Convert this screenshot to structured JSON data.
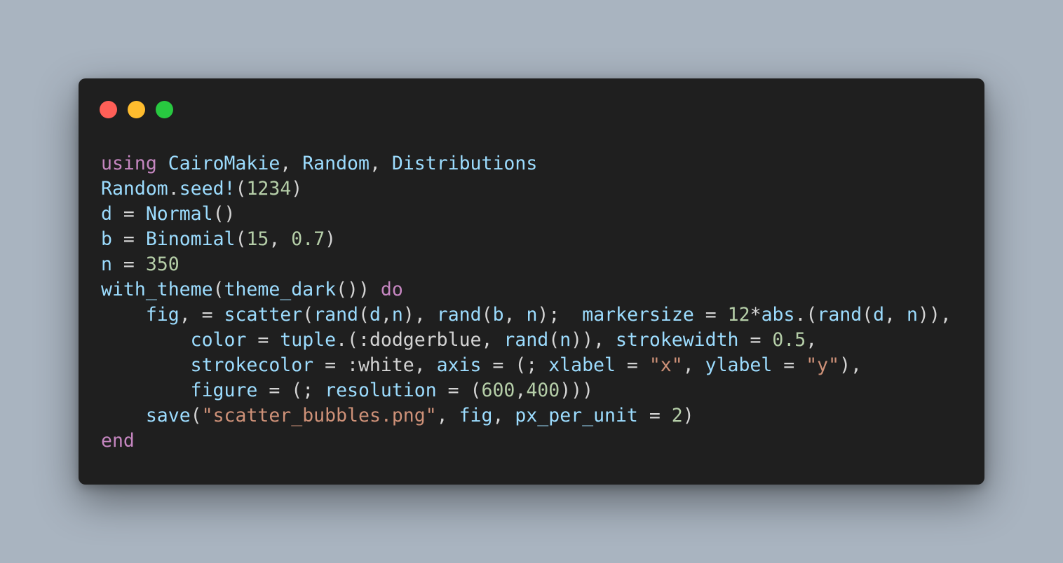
{
  "window": {
    "controls": [
      {
        "name": "close",
        "color": "#ff5f57"
      },
      {
        "name": "minimize",
        "color": "#febc2e"
      },
      {
        "name": "maximize",
        "color": "#28c840"
      }
    ]
  },
  "colors": {
    "keyword": "#c586c0",
    "identifier": "#9cdcfe",
    "number": "#b5cea8",
    "string": "#ce9178",
    "plain": "#d4d4d4"
  },
  "code_lines": [
    [
      [
        "keyword",
        "using"
      ],
      [
        "plain",
        " "
      ],
      [
        "identifier",
        "CairoMakie"
      ],
      [
        "plain",
        ", "
      ],
      [
        "identifier",
        "Random"
      ],
      [
        "plain",
        ", "
      ],
      [
        "identifier",
        "Distributions"
      ]
    ],
    [
      [
        "identifier",
        "Random"
      ],
      [
        "plain",
        "."
      ],
      [
        "identifier",
        "seed!"
      ],
      [
        "plain",
        "("
      ],
      [
        "number",
        "1234"
      ],
      [
        "plain",
        ")"
      ]
    ],
    [
      [
        "identifier",
        "d"
      ],
      [
        "plain",
        " = "
      ],
      [
        "identifier",
        "Normal"
      ],
      [
        "plain",
        "()"
      ]
    ],
    [
      [
        "identifier",
        "b"
      ],
      [
        "plain",
        " = "
      ],
      [
        "identifier",
        "Binomial"
      ],
      [
        "plain",
        "("
      ],
      [
        "number",
        "15"
      ],
      [
        "plain",
        ", "
      ],
      [
        "number",
        "0.7"
      ],
      [
        "plain",
        ")"
      ]
    ],
    [
      [
        "identifier",
        "n"
      ],
      [
        "plain",
        " = "
      ],
      [
        "number",
        "350"
      ]
    ],
    [
      [
        "identifier",
        "with_theme"
      ],
      [
        "plain",
        "("
      ],
      [
        "identifier",
        "theme_dark"
      ],
      [
        "plain",
        "()) "
      ],
      [
        "keyword",
        "do"
      ]
    ],
    [
      [
        "plain",
        "    "
      ],
      [
        "identifier",
        "fig"
      ],
      [
        "plain",
        ", = "
      ],
      [
        "identifier",
        "scatter"
      ],
      [
        "plain",
        "("
      ],
      [
        "identifier",
        "rand"
      ],
      [
        "plain",
        "("
      ],
      [
        "identifier",
        "d"
      ],
      [
        "plain",
        ","
      ],
      [
        "identifier",
        "n"
      ],
      [
        "plain",
        "), "
      ],
      [
        "identifier",
        "rand"
      ],
      [
        "plain",
        "("
      ],
      [
        "identifier",
        "b"
      ],
      [
        "plain",
        ", "
      ],
      [
        "identifier",
        "n"
      ],
      [
        "plain",
        ");  "
      ],
      [
        "identifier",
        "markersize"
      ],
      [
        "plain",
        " = "
      ],
      [
        "number",
        "12"
      ],
      [
        "plain",
        "*"
      ],
      [
        "identifier",
        "abs"
      ],
      [
        "plain",
        ".("
      ],
      [
        "identifier",
        "rand"
      ],
      [
        "plain",
        "("
      ],
      [
        "identifier",
        "d"
      ],
      [
        "plain",
        ", "
      ],
      [
        "identifier",
        "n"
      ],
      [
        "plain",
        ")),"
      ]
    ],
    [
      [
        "plain",
        "        "
      ],
      [
        "identifier",
        "color"
      ],
      [
        "plain",
        " = "
      ],
      [
        "identifier",
        "tuple"
      ],
      [
        "plain",
        ".(:dodgerblue, "
      ],
      [
        "identifier",
        "rand"
      ],
      [
        "plain",
        "("
      ],
      [
        "identifier",
        "n"
      ],
      [
        "plain",
        ")), "
      ],
      [
        "identifier",
        "strokewidth"
      ],
      [
        "plain",
        " = "
      ],
      [
        "number",
        "0.5"
      ],
      [
        "plain",
        ","
      ]
    ],
    [
      [
        "plain",
        "        "
      ],
      [
        "identifier",
        "strokecolor"
      ],
      [
        "plain",
        " = :white, "
      ],
      [
        "identifier",
        "axis"
      ],
      [
        "plain",
        " = (; "
      ],
      [
        "identifier",
        "xlabel"
      ],
      [
        "plain",
        " = "
      ],
      [
        "string",
        "\"x\""
      ],
      [
        "plain",
        ", "
      ],
      [
        "identifier",
        "ylabel"
      ],
      [
        "plain",
        " = "
      ],
      [
        "string",
        "\"y\""
      ],
      [
        "plain",
        "),"
      ]
    ],
    [
      [
        "plain",
        "        "
      ],
      [
        "identifier",
        "figure"
      ],
      [
        "plain",
        " = (; "
      ],
      [
        "identifier",
        "resolution"
      ],
      [
        "plain",
        " = ("
      ],
      [
        "number",
        "600"
      ],
      [
        "plain",
        ","
      ],
      [
        "number",
        "400"
      ],
      [
        "plain",
        ")))"
      ]
    ],
    [
      [
        "plain",
        "    "
      ],
      [
        "identifier",
        "save"
      ],
      [
        "plain",
        "("
      ],
      [
        "string",
        "\"scatter_bubbles.png\""
      ],
      [
        "plain",
        ", "
      ],
      [
        "identifier",
        "fig"
      ],
      [
        "plain",
        ", "
      ],
      [
        "identifier",
        "px_per_unit"
      ],
      [
        "plain",
        " = "
      ],
      [
        "number",
        "2"
      ],
      [
        "plain",
        ")"
      ]
    ],
    [
      [
        "keyword",
        "end"
      ]
    ]
  ]
}
